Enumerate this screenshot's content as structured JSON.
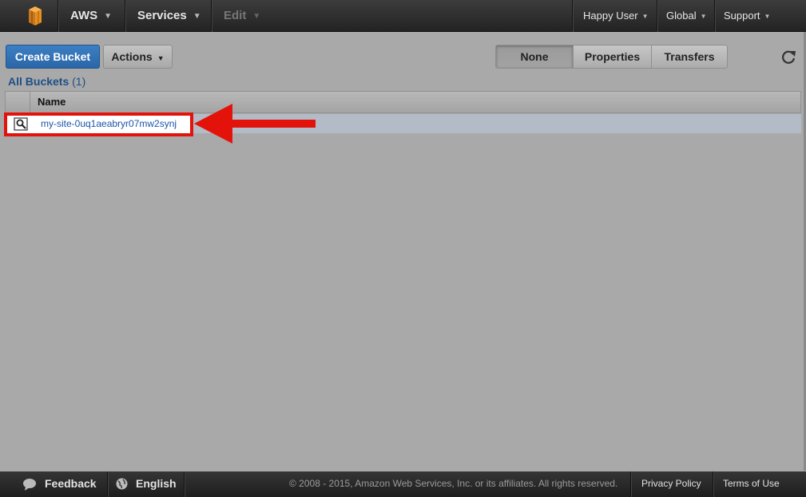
{
  "topbar": {
    "logo_icon": "aws-cube-icon",
    "aws_label": "AWS",
    "services_label": "Services",
    "edit_label": "Edit",
    "user_label": "Happy User",
    "region_label": "Global",
    "support_label": "Support"
  },
  "toolbar": {
    "create_bucket_label": "Create Bucket",
    "actions_label": "Actions",
    "view_tabs": [
      "None",
      "Properties",
      "Transfers"
    ],
    "active_tab": "None",
    "refresh_icon": "refresh-icon"
  },
  "breadcrumb": {
    "label": "All Buckets",
    "count": "(1)"
  },
  "table": {
    "columns": [
      "Name"
    ],
    "rows": [
      {
        "icon": "bucket-magnifier-icon",
        "name": "my-site-0uq1aeabryr07mw2synj"
      }
    ]
  },
  "annotation": {
    "color": "#e3120b"
  },
  "footer": {
    "feedback_label": "Feedback",
    "language_label": "English",
    "copyright": "© 2008 - 2015, Amazon Web Services, Inc. or its affiliates. All rights reserved.",
    "privacy_label": "Privacy Policy",
    "terms_label": "Terms of Use"
  },
  "colors": {
    "primary_button": "#2a66a8",
    "link": "#1a55a8",
    "nav_background": "#232323"
  }
}
